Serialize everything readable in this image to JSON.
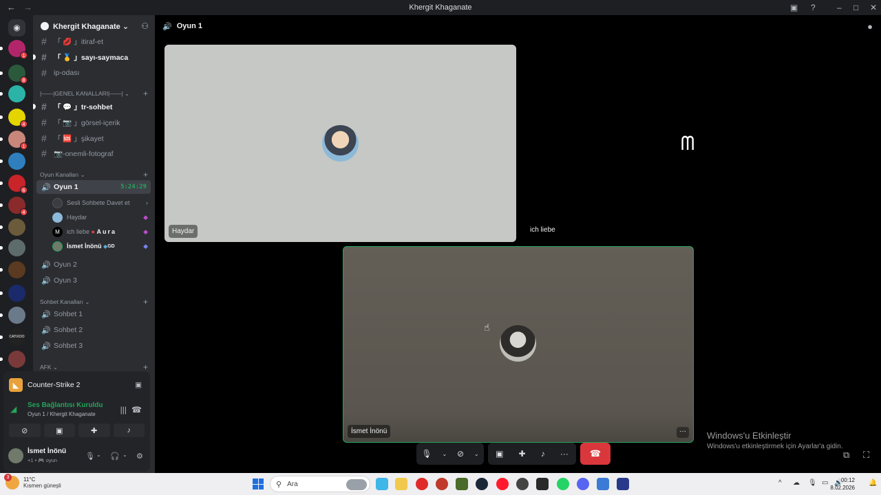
{
  "window": {
    "title": "Khergit Khaganate"
  },
  "guild": {
    "name": "Khergit Khaganate ⌄"
  },
  "text_channels": [
    {
      "name": "「 💋 」itiraf-et",
      "unread": false
    },
    {
      "name": "「 🥇 」sayı-saymaca",
      "unread": true
    },
    {
      "name": "ip-odası",
      "unread": false
    }
  ],
  "categories": {
    "genel": "|——|GENEL KANALLARI|——|",
    "oyun": "Oyun Kanalları",
    "sohbet": "Sohbet Kanalları",
    "afk": "AFK"
  },
  "genel_channels": [
    {
      "name": "「 💬 」tr-sohbet",
      "unread": true
    },
    {
      "name": "「 📷 」görsel-içerik",
      "unread": false
    },
    {
      "name": "「 🆘 」şikayet",
      "unread": false
    },
    {
      "name": "📷-onemli-fotograf",
      "unread": false
    }
  ],
  "voice": {
    "active_channel": "Oyun 1",
    "timer": "5:24:29",
    "invite_label": "Sesli Sohbete Davet et",
    "users": [
      {
        "name": "Haydar",
        "tag": ""
      },
      {
        "name": "ich liebe",
        "tag": "Aura"
      },
      {
        "name": "İsmet İnönü",
        "tag": "GD"
      }
    ],
    "other_oyun": [
      "Oyun 2",
      "Oyun 3"
    ],
    "sohbet": [
      "Sohbet 1",
      "Sohbet 2",
      "Sohbet 3"
    ]
  },
  "panel": {
    "game": "Counter-Strike 2",
    "connection_status": "Ses Bağlantısı Kuruldu",
    "connection_sub": "Oyun 1 / Khergit Khaganate",
    "me_name": "İsmet İnönü",
    "me_sub": "+1 • 🎮 oyun"
  },
  "main": {
    "channel": "Oyun 1",
    "tiles": {
      "haydar": "Haydar",
      "ich": "ich liebe",
      "ismet": "İsmet İnönü"
    }
  },
  "watermark": {
    "line1": "Windows'u Etkinleştir",
    "line2": "Windows'u etkinleştirmek için Ayarlar'a gidin."
  },
  "taskbar": {
    "temp": "11°C",
    "weather": "Kısmen güneşli",
    "weather_badge": "3",
    "search_placeholder": "Ara",
    "time": "00:12",
    "date": "8.02.2026"
  },
  "colors": {
    "accent_green": "#23a55a",
    "danger": "#da373c",
    "mention": "#f23f43"
  }
}
